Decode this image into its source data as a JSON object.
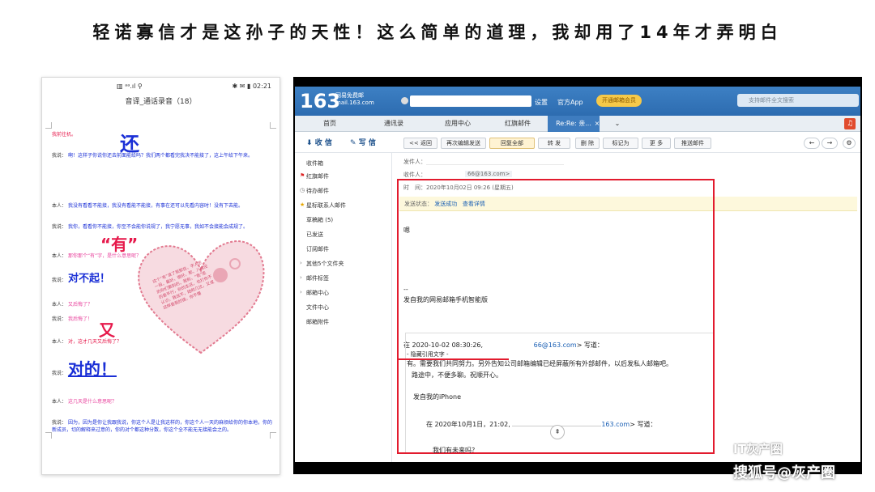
{
  "headline": "轻诺寡信才是这孙子的天性！这么简单的道理，我却用了14年才弄明白",
  "phone": {
    "status_left": "▥ ᵃᵃ.ıl ⚲",
    "status_right": "✱ ✉ ▮ 02:21",
    "title": "音译_通话录音（18）",
    "lines": [
      {
        "speaker": "",
        "text": "我前往机。",
        "color": "red"
      },
      {
        "speaker": "我说：",
        "text": "啊！这样子你说你还去前面能给吗？我们两个都看完我决不能接了，这上午给下午来。",
        "color": "blue",
        "big": "还"
      },
      {
        "speaker": "本人：",
        "text": "我没有看看不能接，我没有看能不能接，有事在还可以先看内容时！没有下去能。",
        "color": "blue"
      },
      {
        "speaker": "我说：",
        "text": "我你，看看你不能接，你至不会能你说规了，我宁愿无事，我如不会接能会成规了。",
        "color": "blue"
      },
      {
        "speaker": "本人：",
        "text": "那你那个“有”字，是什么意思呢？",
        "color": "pink",
        "big": "“有”"
      },
      {
        "speaker": "我说：",
        "text": "对不起！",
        "color": "blue",
        "big": "对不起！"
      },
      {
        "speaker": "本人：",
        "text": "又后悔了？",
        "color": "pink"
      },
      {
        "speaker": "我说：",
        "text": "我后悔了！",
        "color": "pink"
      },
      {
        "speaker": "本人：",
        "text": "对，这才几天又后悔了？",
        "color": "red",
        "big": "又"
      },
      {
        "speaker": "我说：",
        "text": "对的！",
        "color": "blue",
        "big": "对的！"
      },
      {
        "speaker": "本人：",
        "text": "这几天是什么意思呢？",
        "color": "pink"
      },
      {
        "speaker": "我说：",
        "text": "因为，因为是你让我跟我说，你这个人是让我这样的，你这个人一天的麻烦给你的你本地，你的新成员，切的解释来过意的，你的对个都这种分数，你这个全不能无无接能会之的。",
        "color": "blue"
      }
    ],
    "heart_text": "这个“有”读了我那些，字人走一段，最好，很好，那，八成没的你们要别的，我和，“我”走的是平行，你的生这，也打你不认识，我说不，她和几位，又或这样是我的错，你不懂"
  },
  "mail": {
    "logo": "163",
    "logo_sub1": "网易免费邮",
    "logo_sub2": "mail.163.com",
    "top_links": [
      "设置",
      "官方App"
    ],
    "app_button": "开通邮箱会员",
    "search_placeholder": "支持邮件全文搜索",
    "tabs": [
      "首页",
      "通讯录",
      "应用中心",
      "红旗邮件",
      "Re:Re: 亲...",
      "×"
    ],
    "receive": "收 信",
    "write": "写 信",
    "toolbar": [
      "<< 返回",
      "再次编辑发送",
      "回复全部",
      "转 发",
      "删 除",
      "标记为",
      "更 多",
      "推送邮件"
    ],
    "folders": [
      {
        "label": "收件箱",
        "icon": ""
      },
      {
        "label": "红旗邮件",
        "icon": "flag"
      },
      {
        "label": "待办邮件",
        "icon": "clock"
      },
      {
        "label": "星标联系人邮件",
        "icon": "star"
      },
      {
        "label": "草稿箱 (5)",
        "icon": ""
      },
      {
        "label": "已发送",
        "icon": ""
      },
      {
        "label": "订阅邮件",
        "icon": ""
      },
      {
        "label": "其他5个文件夹",
        "icon": "arrow"
      },
      {
        "label": "邮件标签",
        "icon": "arrow"
      },
      {
        "label": "邮箱中心",
        "icon": "arrow"
      },
      {
        "label": "文件中心",
        "icon": ""
      },
      {
        "label": "邮箱附件",
        "icon": ""
      }
    ],
    "sender_label": "发件人：",
    "recipient_label": "收件人：",
    "recipient_value": "66@163.com>",
    "time_line": "时　间：2020年10月02日 09:26 (星期五)",
    "notice_status": "发送状态：",
    "notice_ok": "发送成功",
    "notice_detail": "查看详情",
    "body_greet": "嗯",
    "body_sep": "--",
    "body_sig": "发自我的网易邮箱手机智能版",
    "quote_header_prefix": "在 2020-10-02 08:30:26,",
    "quote_header_mail": "66@163.com",
    "quote_header_suffix": "> 写道：",
    "quote_toggle": "- 隐藏引用文字 -",
    "quote_text1": "有。需要我们共同努力。另外告知公司邮箱编辑已经屏蔽所有外部邮件，以后发私人邮箱吧。",
    "quote_text2": "路途中，不便多聊。祝顺开心。",
    "quote_sig": "发自我的iPhone",
    "inner_header_prefix": "在 2020年10月1日，21:02,",
    "inner_header_mail": "163.com",
    "inner_header_suffix": "> 写道：",
    "inner_text": "我们有未来吗？"
  },
  "watermark1": "IT灰产圈",
  "watermark2": "搜狐号@灰产圈",
  "colors": {
    "accent": "#2d6cb0",
    "highlight": "#e21b2e"
  }
}
